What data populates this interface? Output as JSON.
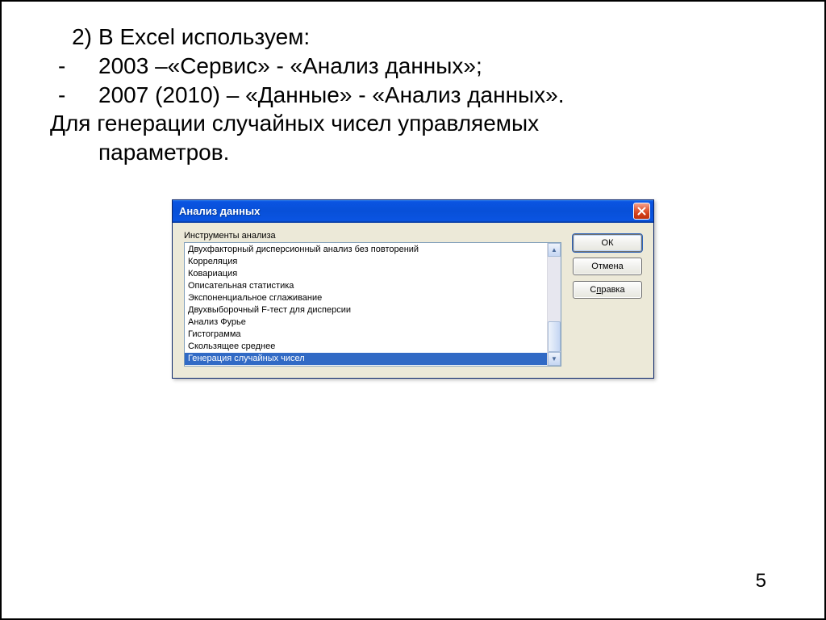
{
  "text": {
    "line1_num": "2)",
    "line1_txt": "В Excel используем:",
    "line2_dash": "-",
    "line2_txt": "2003 –«Сервис» - «Анализ данных»;",
    "line3_dash": "-",
    "line3_txt": "2007 (2010) – «Данные» - «Анализ данных».",
    "line4": "Для генерации случайных чисел управляемых",
    "line5": "параметров."
  },
  "dialog": {
    "title": "Анализ данных",
    "group_label": "Инструменты анализа",
    "items": [
      "Двухфакторный дисперсионный анализ без повторений",
      "Корреляция",
      "Ковариация",
      "Описательная статистика",
      "Экспоненциальное сглаживание",
      "Двухвыборочный F-тест для дисперсии",
      "Анализ Фурье",
      "Гистограмма",
      "Скользящее среднее",
      "Генерация случайных чисел"
    ],
    "selected_index": 9,
    "buttons": {
      "ok": "ОК",
      "cancel": "Отмена",
      "help_pre": "С",
      "help_ul": "п",
      "help_post": "равка"
    }
  },
  "page_number": "5"
}
